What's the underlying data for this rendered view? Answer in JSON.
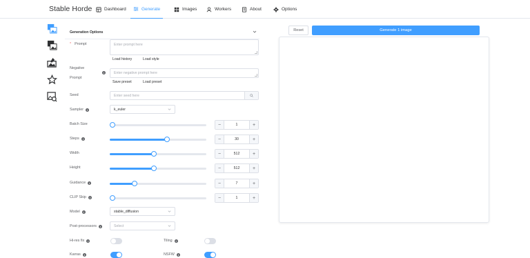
{
  "app_title": "Stable Horde",
  "nav": [
    {
      "label": "Dashboard",
      "icon": "dashboard-icon"
    },
    {
      "label": "Generate",
      "icon": "sliders-icon",
      "active": true
    },
    {
      "label": "Images",
      "icon": "images-grid-icon"
    },
    {
      "label": "Workers",
      "icon": "user-icon"
    },
    {
      "label": "About",
      "icon": "document-icon"
    },
    {
      "label": "Options",
      "icon": "gear-icon"
    }
  ],
  "sidebar_icons": [
    "text2img-icon",
    "img2img-icon",
    "inpainting-icon",
    "rating-icon",
    "interrogation-icon"
  ],
  "section_title": "Generation Options",
  "prompt": {
    "label": "Prompt",
    "placeholder": "Enter prompt here",
    "load_history": "Load history",
    "load_style": "Load style"
  },
  "negative_prompt": {
    "label_line1": "Negative",
    "label_line2": "Prompt",
    "placeholder": "Enter negative prompt here",
    "save_preset": "Save preset",
    "load_preset": "Load preset"
  },
  "seed": {
    "label": "Seed",
    "placeholder": "Enter seed here"
  },
  "sampler": {
    "label": "Sampler",
    "value": "k_euler"
  },
  "sliders": [
    {
      "label": "Batch Size",
      "value": "1",
      "fraction": 0.0
    },
    {
      "label": "Steps",
      "value": "30",
      "fraction": 0.59
    },
    {
      "label": "Width",
      "value": "512",
      "fraction": 0.46
    },
    {
      "label": "Height",
      "value": "512",
      "fraction": 0.46
    },
    {
      "label": "Guidance",
      "value": "7",
      "fraction": 0.26
    },
    {
      "label": "CLIP Skip",
      "value": "1",
      "fraction": 0.0
    }
  ],
  "model": {
    "label": "Model",
    "value": "stable_diffusion"
  },
  "post_processors": {
    "label": "Post-processors",
    "placeholder": "Select"
  },
  "toggles": [
    {
      "label": "Hi-res fix",
      "on": false
    },
    {
      "label": "Tiling",
      "on": false
    },
    {
      "label": "Karras",
      "on": true
    },
    {
      "label": "NSFW",
      "on": true
    }
  ],
  "actions": {
    "reset": "Reset",
    "generate": "Generate 1 image"
  },
  "colors": {
    "accent": "#409eff",
    "border": "#dcdfe6"
  }
}
